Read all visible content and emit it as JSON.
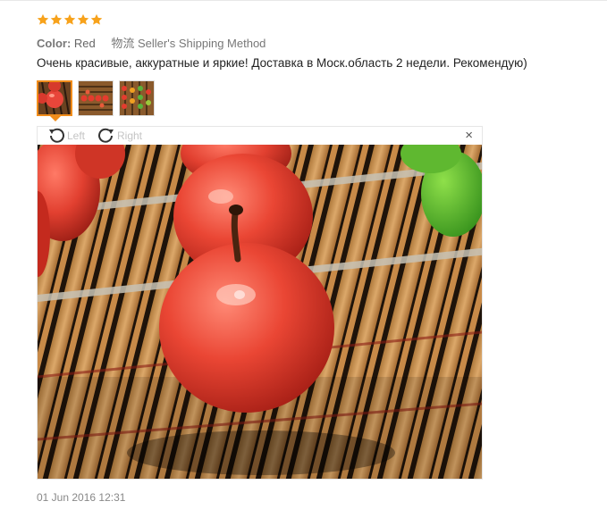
{
  "review": {
    "rating": 5,
    "star_color": "#f7a21b",
    "color_label": "Color:",
    "color_value": "Red",
    "shipping_value": "物流 Seller's Shipping Method",
    "text": "Очень красивые, аккуратные и яркие! Доставка в Моск.область 2 недели. Рекомендую)",
    "date": "01 Jun 2016 12:31"
  },
  "thumbnails": [
    {
      "name": "photo-thumbnail-1",
      "active": true
    },
    {
      "name": "photo-thumbnail-2",
      "active": false
    },
    {
      "name": "photo-thumbnail-3",
      "active": false
    }
  ],
  "viewer": {
    "rotate_left_label": "Left",
    "rotate_right_label": "Right",
    "close_glyph": "×",
    "icons": [
      "rotate-left-icon",
      "rotate-right-icon",
      "close-icon"
    ]
  },
  "colors": {
    "accent": "#f08c1a",
    "text_muted": "#777777",
    "disabled_label": "#c4c4c4"
  }
}
